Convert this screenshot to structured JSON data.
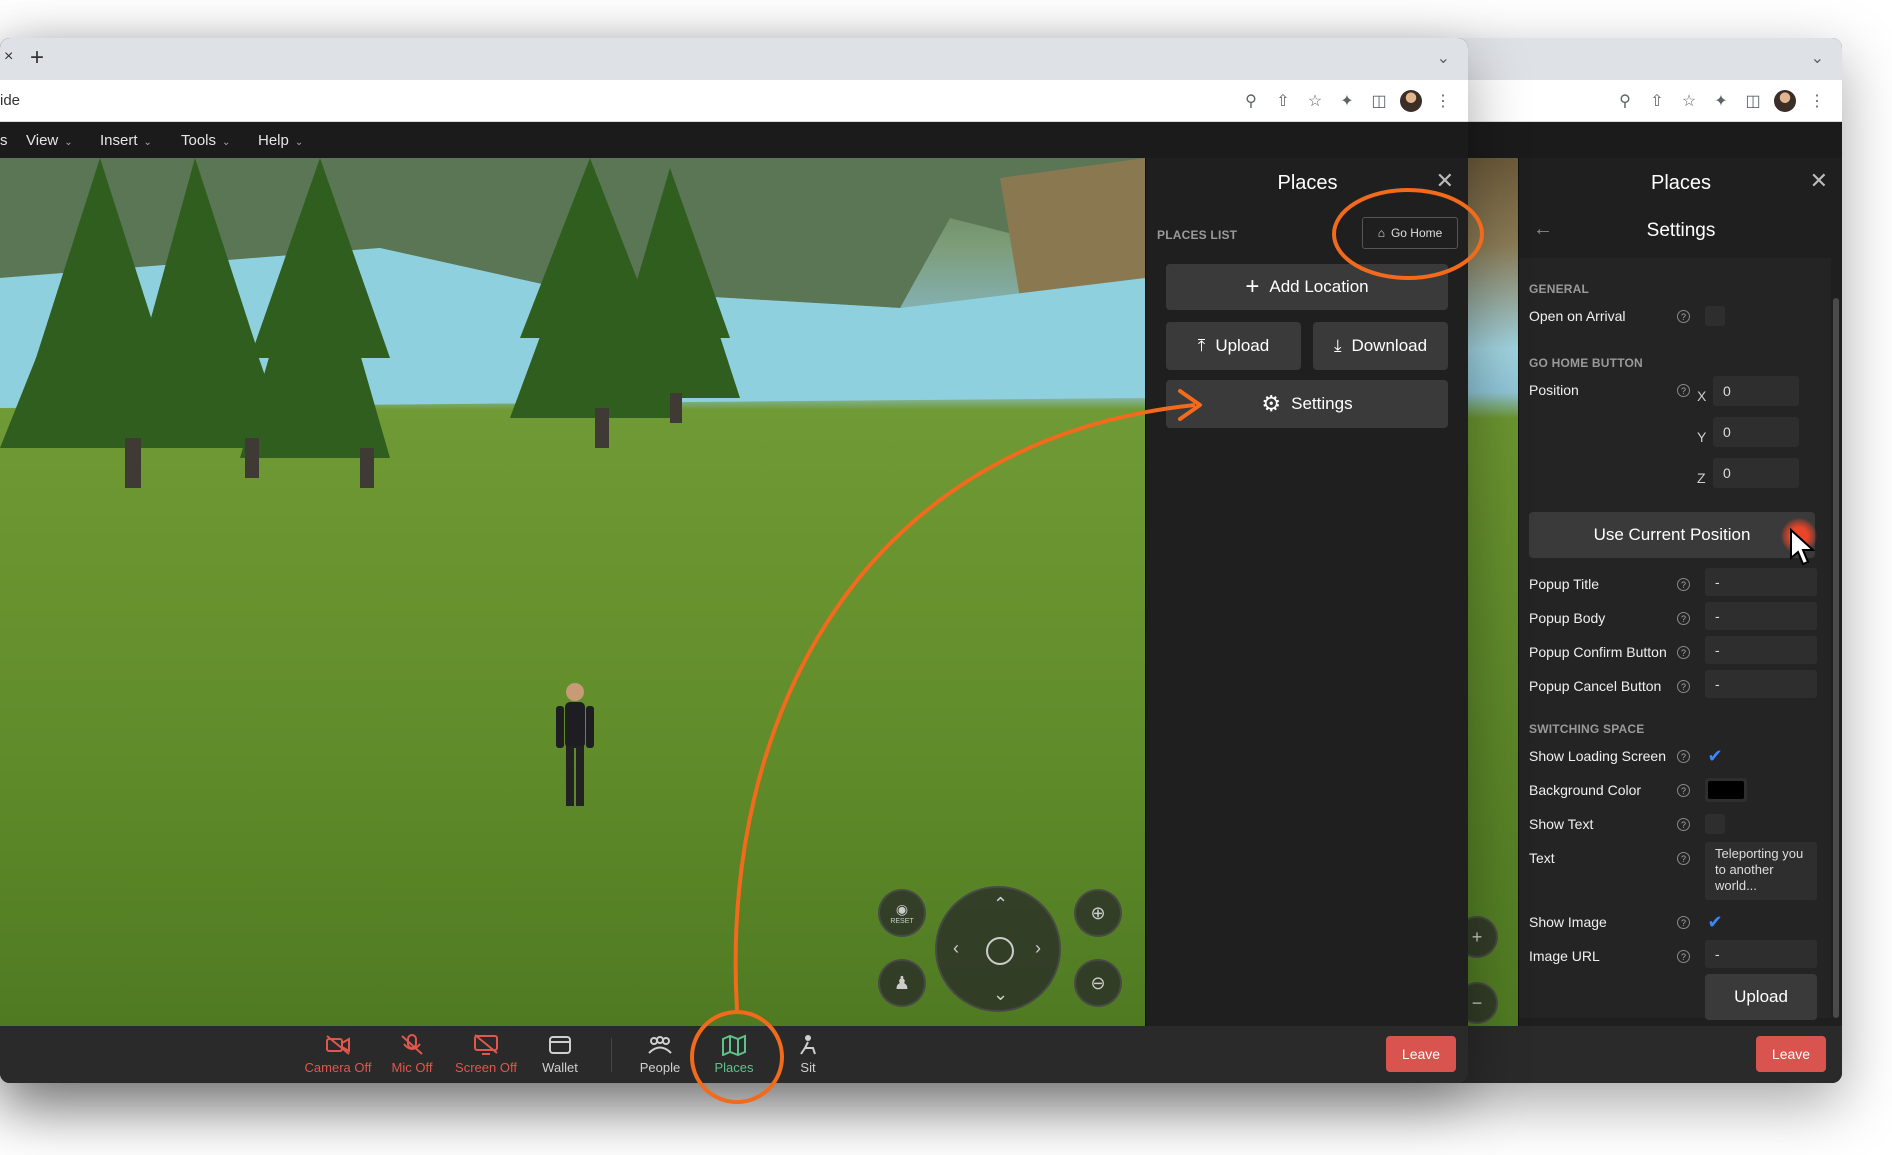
{
  "browser": {
    "new_tab": "+",
    "tab_overflow": "⌄",
    "address_fragment": "ide"
  },
  "menubar": {
    "items": [
      {
        "label": "s"
      },
      {
        "label": "View"
      },
      {
        "label": "Insert"
      },
      {
        "label": "Tools"
      },
      {
        "label": "Help"
      }
    ]
  },
  "places_panel": {
    "title": "Places",
    "list_label": "PLACES LIST",
    "go_home": "Go Home",
    "add_location": "Add Location",
    "upload": "Upload",
    "download": "Download",
    "settings": "Settings"
  },
  "settings_panel": {
    "title": "Places",
    "subtitle": "Settings",
    "general_label": "GENERAL",
    "open_on_arrival": "Open on Arrival",
    "go_home_button_label": "GO HOME BUTTON",
    "position_label": "Position",
    "x_label": "X",
    "y_label": "Y",
    "z_label": "Z",
    "x_value": "0",
    "y_value": "0",
    "z_value": "0",
    "use_current_position": "Use Current Position",
    "popup_title": "Popup Title",
    "popup_title_value": "-",
    "popup_body": "Popup Body",
    "popup_body_value": "-",
    "popup_confirm": "Popup Confirm Button",
    "popup_confirm_value": "-",
    "popup_cancel": "Popup Cancel Button",
    "popup_cancel_value": "-",
    "switching_space_label": "SWITCHING SPACE",
    "show_loading_screen": "Show Loading Screen",
    "background_color": "Background Color",
    "background_color_value": "#000000",
    "show_text": "Show Text",
    "text_label": "Text",
    "text_value": "Teleporting you to another world...",
    "show_image": "Show Image",
    "image_url": "Image URL",
    "image_url_value": "-",
    "upload": "Upload",
    "help_glyph": "?",
    "check_glyph": "✔"
  },
  "controls": {
    "reset": "RESET"
  },
  "bottom_bar": {
    "camera": "Camera Off",
    "mic": "Mic Off",
    "screen": "Screen Off",
    "wallet": "Wallet",
    "people": "People",
    "places": "Places",
    "sit": "Sit",
    "leave": "Leave"
  },
  "colors": {
    "accent_orange": "#f26a1b",
    "muted_red": "#e0574d",
    "active_green": "#5fc18a",
    "leave_red": "#d9534f",
    "check_blue": "#3a86ff"
  }
}
